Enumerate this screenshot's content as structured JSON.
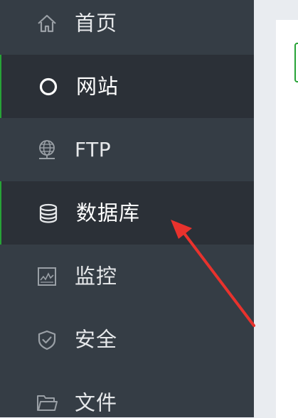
{
  "sidebar": {
    "items": [
      {
        "label": "首页",
        "icon": "home-icon"
      },
      {
        "label": "网站",
        "icon": "website-circle-icon"
      },
      {
        "label": "FTP",
        "icon": "ftp-globe-icon"
      },
      {
        "label": "数据库",
        "icon": "database-icon"
      },
      {
        "label": "监控",
        "icon": "monitor-chart-icon"
      },
      {
        "label": "安全",
        "icon": "shield-check-icon"
      },
      {
        "label": "文件",
        "icon": "folder-icon"
      }
    ],
    "highlighted": [
      "网站",
      "数据库"
    ]
  },
  "colors": {
    "sidebar_bg": "#353d45",
    "sidebar_highlight_bg": "#2b3037",
    "accent_green": "#27a337",
    "annotation_red": "#e8322d",
    "icon_gray": "#9aa0a6"
  }
}
